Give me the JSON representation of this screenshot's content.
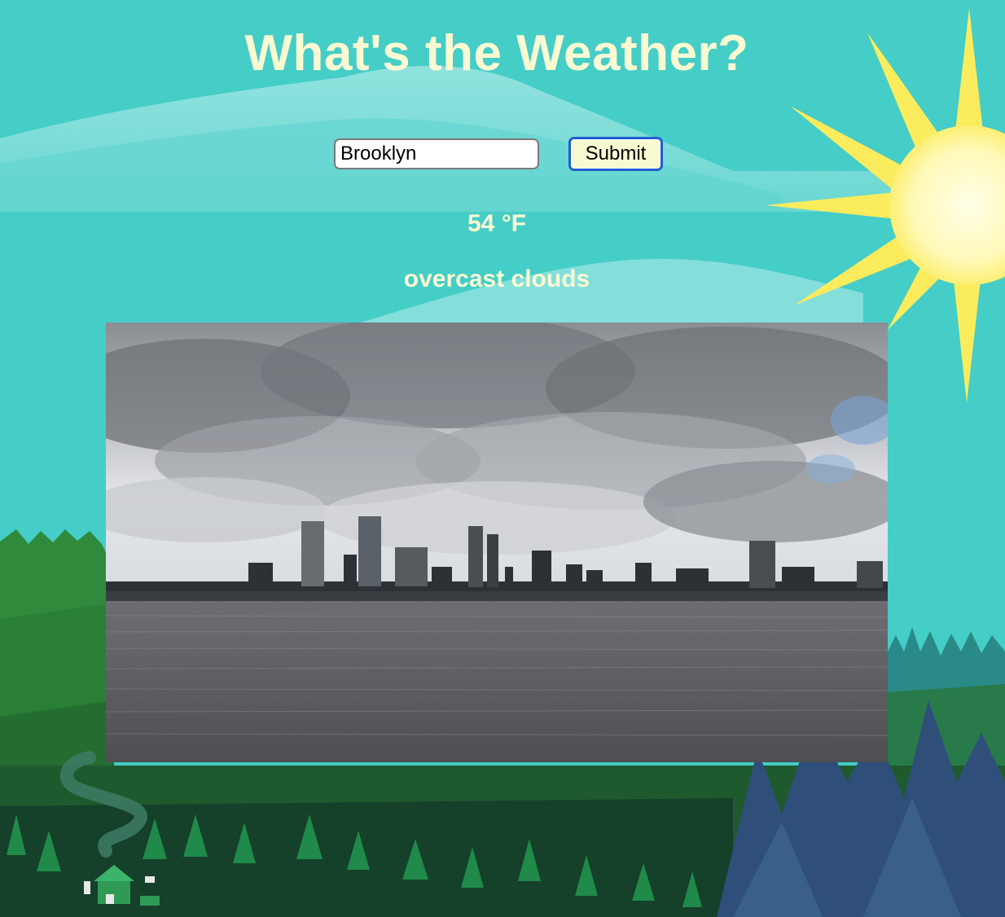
{
  "header": {
    "title": "What's the Weather?"
  },
  "search": {
    "value": "Brooklyn"
  },
  "submit": {
    "label": "Submit"
  },
  "weather": {
    "temperature": "54 °F",
    "description": "overcast clouds"
  },
  "photo": {
    "subject": "city skyline across water under overcast clouds"
  },
  "colors": {
    "sky": "#45cdc7",
    "title_text": "#fafad2",
    "sun": "#fbec5d",
    "button_bg": "#fafad2",
    "button_border": "#1f5fd1"
  },
  "icons": {
    "sun": "sun-icon"
  }
}
